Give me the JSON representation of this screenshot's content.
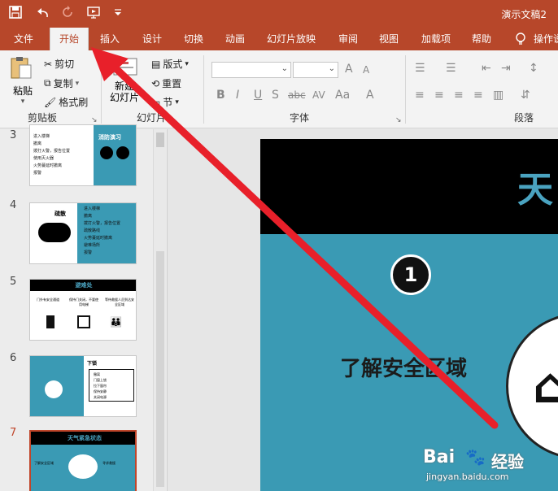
{
  "window": {
    "title": "演示文稿2"
  },
  "tabs": [
    "文件",
    "开始",
    "插入",
    "设计",
    "切换",
    "动画",
    "幻灯片放映",
    "审阅",
    "视图",
    "加载项",
    "帮助",
    "操作说"
  ],
  "ribbon": {
    "clipboard": {
      "label": "剪贴板",
      "paste": "粘贴",
      "cut": "剪切",
      "copy": "复制",
      "format_painter": "格式刷"
    },
    "slides": {
      "label": "幻灯片",
      "new_slide": "新建\n幻灯片",
      "layout": "版式",
      "reset": "重置",
      "section": "节"
    },
    "font": {
      "label": "字体",
      "bold": "B",
      "italic": "I",
      "underline": "U",
      "strike": "S",
      "grow": "A",
      "shrink": "A",
      "clear": "A"
    },
    "paragraph": {
      "label": "段落"
    }
  },
  "thumbnails": [
    {
      "number": "3",
      "title": "消防演习",
      "bullets": [
        "进入楼梯",
        "撤离",
        "拨打火警，报告位置",
        "使用灭火器",
        "火势蔓延时撤离",
        "报警"
      ]
    },
    {
      "number": "4",
      "title": "疏散",
      "bullets": [
        "进入楼梯",
        "撤离",
        "拨打火警，报告位置",
        "疏散路线",
        "火势蔓延时撤离",
        "避难场所",
        "报警"
      ]
    },
    {
      "number": "5",
      "title": "避难处",
      "cols": [
        "门外有安全通道",
        "保持门关闭，不要使用电梯",
        "等待救援人员到达安全区域"
      ]
    },
    {
      "number": "6",
      "title": "下锁",
      "bullets": [
        "撤离",
        "门窗上锁",
        "拉下窗帘",
        "保持安静",
        "关闭电源"
      ]
    },
    {
      "number": "7",
      "title": "天气紧急状态",
      "cols": [
        "了解安全区域",
        "避难所",
        "寻求救援"
      ]
    }
  ],
  "slide": {
    "title": "天",
    "step_number": "1",
    "text": "了解安全区域"
  },
  "watermark": {
    "brand": "Bai",
    "brand2": "经验",
    "url": "jingyan.baidu.com"
  },
  "colors": {
    "accent": "#b7472a",
    "slide_blue": "#3a9ab4",
    "arrow": "#e8202a"
  }
}
